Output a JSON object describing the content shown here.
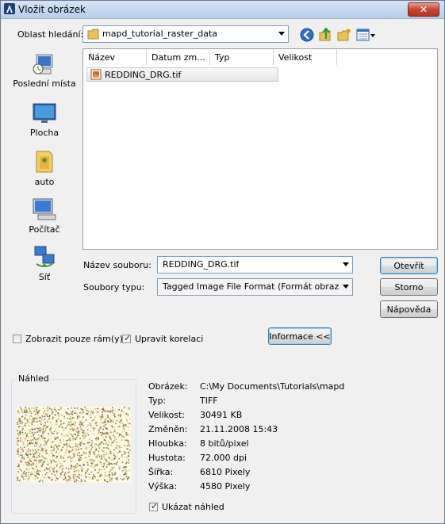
{
  "window": {
    "title": "Vložit obrázek",
    "close_label": "✕"
  },
  "lookin": {
    "label": "Oblast hledání:",
    "value": "mapd_tutorial_raster_data"
  },
  "toolbar_icons": [
    "back-icon",
    "up-folder-icon",
    "new-folder-icon",
    "views-icon"
  ],
  "places": [
    {
      "label": "Poslední místa",
      "icon": "recent-places-icon"
    },
    {
      "label": "Plocha",
      "icon": "desktop-icon"
    },
    {
      "label": "auto",
      "icon": "user-folder-icon"
    },
    {
      "label": "Počítač",
      "icon": "computer-icon"
    },
    {
      "label": "Síť",
      "icon": "network-icon"
    }
  ],
  "filelist": {
    "columns": [
      "Název",
      "Datum zm...",
      "Typ",
      "Velikost"
    ],
    "files": [
      {
        "name": "REDDING_DRG.tif",
        "icon": "image-file-icon"
      }
    ]
  },
  "filename": {
    "label": "Název souboru:",
    "value": "REDDING_DRG.tif"
  },
  "filetype": {
    "label": "Soubory typu:",
    "value": "Tagged Image File Format (Formát obrazového"
  },
  "buttons": {
    "open": "Otevřít",
    "cancel": "Storno",
    "help": "Nápověda",
    "info": "Informace <<"
  },
  "checkboxes": {
    "frame_only": {
      "label": "Zobrazit pouze rám(y)",
      "checked": false
    },
    "correlation": {
      "label": "Upravit korelaci",
      "checked": true
    },
    "show_preview": {
      "label": "Ukázat náhled",
      "checked": true
    }
  },
  "preview_title": "Náhled",
  "info": [
    {
      "key": "Obrázek:",
      "value": "C:\\My Documents\\Tutorials\\mapd"
    },
    {
      "key": "Typ:",
      "value": "TIFF"
    },
    {
      "key": "Velikost:",
      "value": "30491 KB"
    },
    {
      "key": "Změněn:",
      "value": "21.11.2008 15:43"
    },
    {
      "key": "Hloubka:",
      "value": "8 bitů/pixel"
    },
    {
      "key": "Hustota:",
      "value": "72.000 dpi"
    },
    {
      "key": "Šířka:",
      "value": "6810 Pixely"
    },
    {
      "key": "Výška:",
      "value": "4580 Pixely"
    }
  ]
}
